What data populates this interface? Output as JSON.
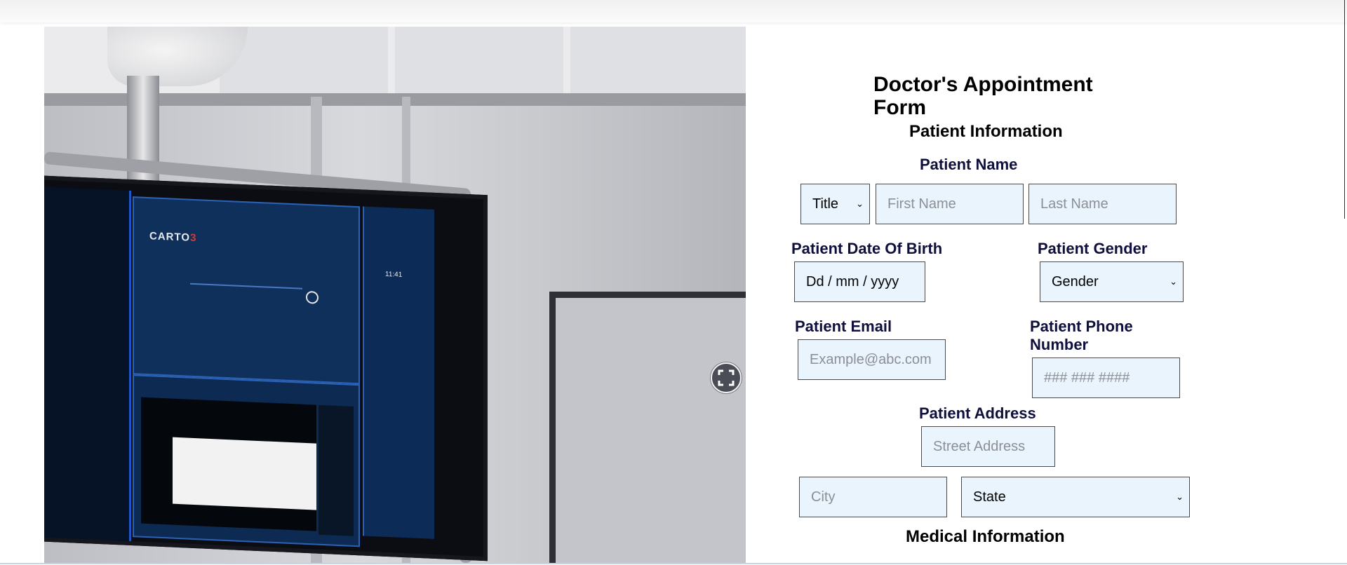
{
  "form": {
    "title": "Doctor's Appointment Form",
    "patient_section": "Patient Information",
    "name_label": "Patient Name",
    "title_select": "Title",
    "first_name_placeholder": "First Name",
    "last_name_placeholder": "Last Name",
    "dob_label": "Patient Date Of Birth",
    "dob_placeholder": "Dd / mm / yyyy",
    "gender_label": "Patient Gender",
    "gender_select": "Gender",
    "email_label": "Patient Email",
    "email_placeholder": "Example@abc.com",
    "phone_label": "Patient Phone Number",
    "phone_placeholder": "### ### ####",
    "address_label": "Patient Address",
    "street_placeholder": "Street Address",
    "city_placeholder": "City",
    "state_select": "State",
    "medical_section": "Medical Information"
  },
  "photo": {
    "screen_brand": "CARTO",
    "screen_brand_mark": "3",
    "screen_clock": "11:41"
  },
  "icons": {
    "expand": "expand-icon",
    "chevron": "chevron-down-icon",
    "power": "power-icon"
  },
  "colors": {
    "input_bg": "#e9f4fd",
    "label_text": "#0f0f3d",
    "screen_accent": "#1e55c8"
  }
}
